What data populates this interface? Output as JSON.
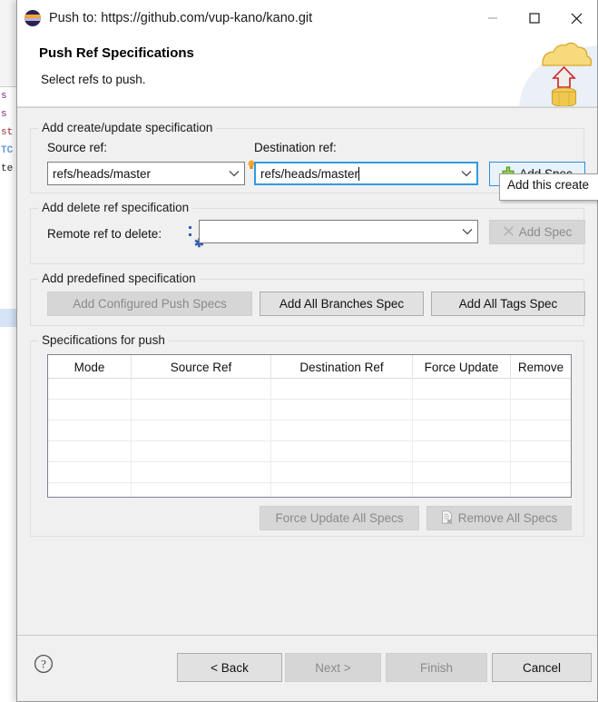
{
  "window": {
    "title": "Push to: https://github.com/vup-kano/kano.git",
    "app_icon": "eclipse-icon",
    "minimize_label": "Minimize",
    "maximize_label": "Maximize",
    "close_label": "Close"
  },
  "banner": {
    "title": "Push Ref Specifications",
    "subtitle": "Select refs to push.",
    "art": "cloud-upload-database-icon"
  },
  "create_group": {
    "legend": "Add create/update specification",
    "source_label": "Source ref:",
    "source_value": "refs/heads/master",
    "destination_label": "Destination ref:",
    "destination_value": "refs/heads/master",
    "add_spec_label": "Add Spec",
    "add_spec_icon": "plus-icon"
  },
  "delete_group": {
    "legend": "Add delete ref specification",
    "remote_label": "Remote ref to delete:",
    "remote_value": "",
    "remote_placeholder": "",
    "add_spec_label": "Add Spec",
    "add_spec_icon": "x-remove-icon"
  },
  "predefined_group": {
    "legend": "Add predefined specification",
    "buttons": [
      {
        "label": "Add Configured Push Specs",
        "enabled": false
      },
      {
        "label": "Add All Branches Spec",
        "enabled": true
      },
      {
        "label": "Add All Tags Spec",
        "enabled": true
      }
    ]
  },
  "specs_group": {
    "legend": "Specifications for push",
    "columns": [
      "Mode",
      "Source Ref",
      "Destination Ref",
      "Force Update",
      "Remove"
    ],
    "rows": [],
    "empty_row_count": 6,
    "force_update_all_label": "Force Update All Specs",
    "remove_all_label": "Remove All Specs",
    "remove_all_icon": "document-remove-icon"
  },
  "tooltip": {
    "text": "Add this create"
  },
  "footer": {
    "help_icon": "help-question-icon",
    "back_label": "< Back",
    "next_label": "Next >",
    "finish_label": "Finish",
    "cancel_label": "Cancel"
  },
  "background_editor": {
    "lines": [
      "s",
      "s",
      "st",
      "TC",
      "te"
    ]
  },
  "colors": {
    "dialog_bg": "#f0f0f0",
    "accent_focus": "#3399de",
    "primary_button_bg": "#e8f2fb",
    "disabled_text": "#8a8a8a",
    "cloud": "#f5d76e",
    "arrow": "#cc2222"
  }
}
